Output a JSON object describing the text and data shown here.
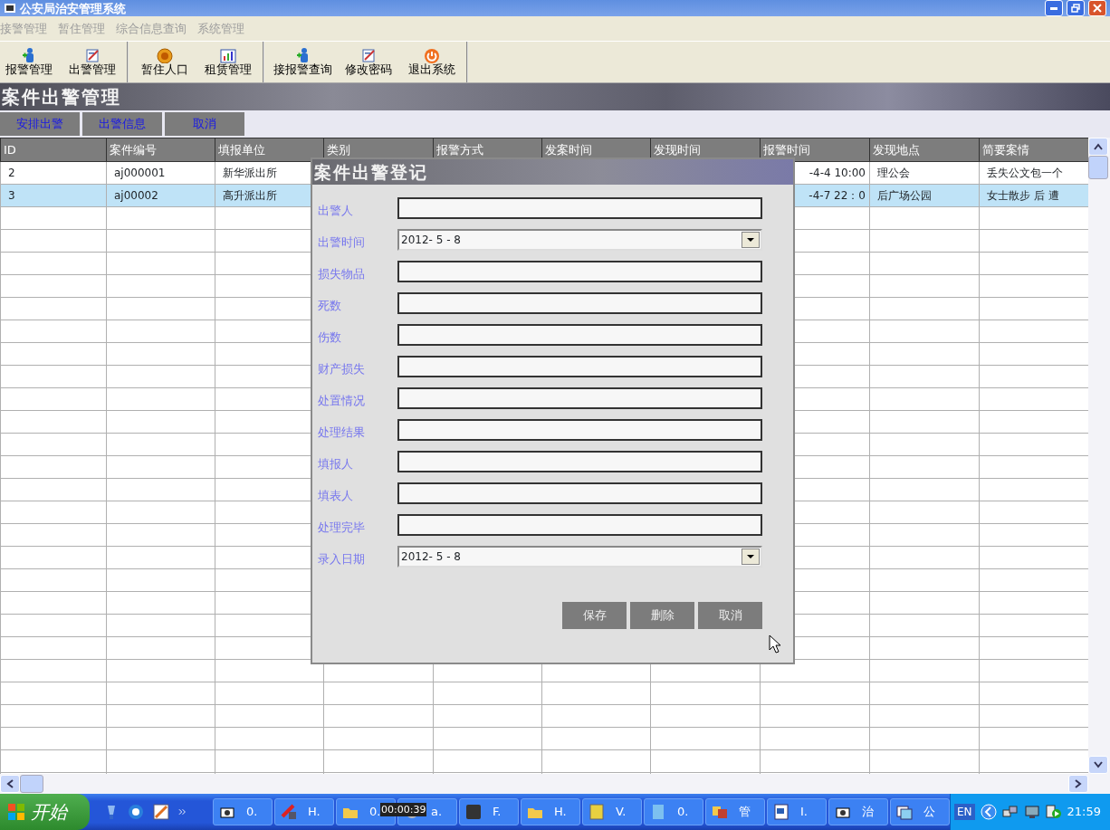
{
  "window": {
    "title": "公安局治安管理系统"
  },
  "menu": [
    {
      "label": "接警管理",
      "disabled": true
    },
    {
      "label": "暂住管理",
      "disabled": true
    },
    {
      "label": "综合信息查询",
      "disabled": true
    },
    {
      "label": "系统管理",
      "disabled": true
    }
  ],
  "toolbar_groups": [
    [
      {
        "label": "报警管理"
      },
      {
        "label": "出警管理"
      }
    ],
    [
      {
        "label": "暂住人口"
      },
      {
        "label": "租赁管理"
      }
    ],
    [
      {
        "label": "接报警查询"
      },
      {
        "label": "修改密码"
      },
      {
        "label": "退出系统"
      }
    ]
  ],
  "banner": {
    "title": "案件出警管理"
  },
  "actions": [
    "安排出警",
    "出警信息",
    "取消"
  ],
  "table": {
    "columns": [
      "ID",
      "案件编号",
      "填报单位",
      "类别",
      "报警方式",
      "发案时间",
      "发现时间",
      "报警时间",
      "发现地点",
      "简要案情"
    ],
    "rows": [
      {
        "selected": false,
        "cells": [
          "2",
          "aj000001",
          "新华派出所",
          null,
          null,
          null,
          null,
          "-4-4 10:00",
          "理公会",
          "丢失公文包一个"
        ]
      },
      {
        "selected": true,
        "cells": [
          "3",
          "aj00002",
          "高升派出所",
          null,
          null,
          null,
          null,
          "-4-7 22：0",
          "后广场公园",
          "女士散步 后 遭"
        ]
      }
    ]
  },
  "dialog": {
    "title": "案件出警登记",
    "fields": [
      {
        "label": "出警人",
        "kind": "text"
      },
      {
        "label": "出警时间",
        "kind": "date",
        "value": "2012- 5 - 8"
      },
      {
        "label": "损失物品",
        "kind": "text"
      },
      {
        "label": "死数",
        "kind": "text"
      },
      {
        "label": "伤数",
        "kind": "text"
      },
      {
        "label": "财产损失",
        "kind": "text"
      },
      {
        "label": "处置情况",
        "kind": "text"
      },
      {
        "label": "处理结果",
        "kind": "text"
      },
      {
        "label": "填报人",
        "kind": "text"
      },
      {
        "label": "填表人",
        "kind": "text"
      },
      {
        "label": "处理完毕",
        "kind": "text"
      },
      {
        "label": "录入日期",
        "kind": "date",
        "value": "2012- 5 - 8"
      }
    ],
    "buttons": [
      "保存",
      "删除",
      "取消"
    ]
  },
  "taskbar": {
    "start": "开始",
    "tasks": [
      {
        "label": "0."
      },
      {
        "label": "H."
      },
      {
        "label": "0."
      },
      {
        "label": "a."
      },
      {
        "label": "F."
      },
      {
        "label": "H."
      },
      {
        "label": "V."
      },
      {
        "label": "0."
      },
      {
        "label": "管"
      },
      {
        "label": "I."
      },
      {
        "label": "治"
      },
      {
        "label": "公"
      }
    ],
    "tooltip": "00:00:39",
    "language": "EN",
    "clock": "21:59"
  }
}
